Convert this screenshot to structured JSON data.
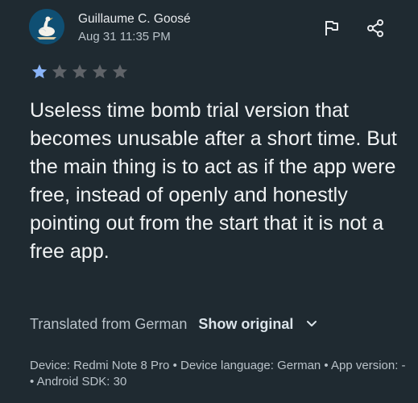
{
  "reviewer": {
    "name": "Guillaume C. Goosé",
    "date": "Aug 31 11:35 PM",
    "avatar": "goose-avatar"
  },
  "actions": {
    "flag_icon": "flag-icon",
    "share_icon": "share-icon"
  },
  "rating": {
    "value": 1,
    "max": 5
  },
  "review": {
    "text": "Useless time bomb trial version that becomes unusable after a short time. But the main thing is to act as if the app were free, instead of openly and honestly pointing out from the start that it is not a free app."
  },
  "translation": {
    "note": "Translated from German",
    "show_original": "Show original",
    "chevron_icon": "chevron-down-icon"
  },
  "device": {
    "info": "Device: Redmi Note 8 Pro • Device language: German • App version: - • Android SDK: 30"
  },
  "colors": {
    "background": "#1f2a31",
    "star_filled": "#8ab4f8",
    "star_empty": "#5f6368",
    "avatar_bg": "#0f4f73"
  }
}
